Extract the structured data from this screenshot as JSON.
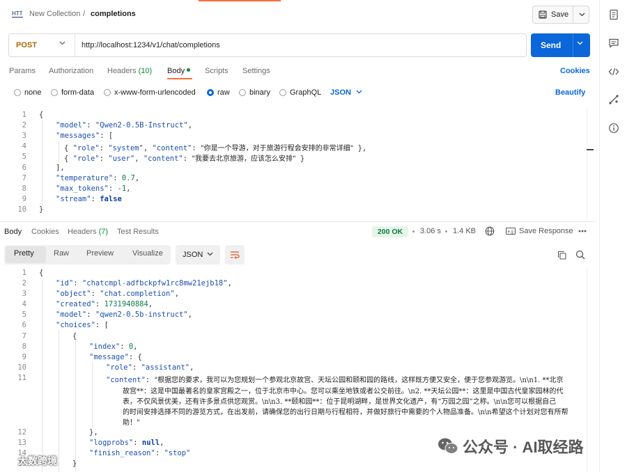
{
  "header": {
    "collection": "New Collection",
    "separator": "/",
    "request_name": "completions",
    "save_label": "Save"
  },
  "url_bar": {
    "method": "POST",
    "url": "http://localhost:1234/v1/chat/completions",
    "send_label": "Send"
  },
  "request_tabs": {
    "params": "Params",
    "authorization": "Authorization",
    "headers": "Headers",
    "headers_count": "(10)",
    "body": "Body",
    "scripts": "Scripts",
    "settings": "Settings",
    "cookies": "Cookies"
  },
  "body_types": {
    "none": "none",
    "form_data": "form-data",
    "urlencoded": "x-www-form-urlencoded",
    "raw": "raw",
    "binary": "binary",
    "graphql": "GraphQL",
    "format": "JSON",
    "beautify": "Beautify"
  },
  "request_body": {
    "lines": [
      "1",
      "2",
      "3",
      "4",
      "5",
      "6",
      "7",
      "8",
      "9",
      "10"
    ],
    "model_key": "\"model\"",
    "model_val": "\"Qwen2-0.5B-Instruct\"",
    "messages_key": "\"messages\"",
    "role_key": "\"role\"",
    "content_key": "\"content\"",
    "system_val": "\"system\"",
    "system_content": "\"你是一个导游，对于旅游行程会安排的非常详细\"",
    "user_val": "\"user\"",
    "user_content": "\"我要去北京旅游，应该怎么安排\"",
    "temperature_key": "\"temperature\"",
    "temperature_val": "0.7",
    "max_tokens_key": "\"max_tokens\"",
    "max_tokens_val": "-1",
    "stream_key": "\"stream\"",
    "stream_val": "false"
  },
  "response_tabs": {
    "body": "Body",
    "cookies": "Cookies",
    "headers": "Headers",
    "headers_count": "(7)",
    "test_results": "Test Results",
    "status": "200 OK",
    "time": "3.06 s",
    "size": "1.4 KB",
    "save_response": "Save Response"
  },
  "view_tabs": {
    "pretty": "Pretty",
    "raw": "Raw",
    "preview": "Preview",
    "visualize": "Visualize",
    "format": "JSON"
  },
  "response_body": {
    "lines": [
      "1",
      "2",
      "3",
      "4",
      "5",
      "6",
      "7",
      "8",
      "9",
      "10",
      "11",
      "12",
      "13",
      "14",
      "15"
    ],
    "id_key": "\"id\"",
    "id_val": "\"chatcmpl-adfbckpfw1rc8mw21ejb18\"",
    "object_key": "\"object\"",
    "object_val": "\"chat.completion\"",
    "created_key": "\"created\"",
    "created_val": "1731940884",
    "model_key": "\"model\"",
    "model_val": "\"qwen2-0.5b-instruct\"",
    "choices_key": "\"choices\"",
    "index_key": "\"index\"",
    "index_val": "0",
    "message_key": "\"message\"",
    "role_key": "\"role\"",
    "role_val": "\"assistant\"",
    "content_key": "\"content\"",
    "content_line1": "\"根据您的要求，我可以为您规划一个参观北京故宫、天坛公园和颐和园的路线，这样既方便又安全，便于您参观游览。\\n\\n1. **北京",
    "content_line2": "故宫**：这是中国最著名的皇家宫殿之一，位于北京市中心。您可以乘坐地铁或者公交前往。\\n2. **天坛公园**：这里是中国古代皇家园林的代",
    "content_line3": "表，不仅风景优美，还有许多景点供您观赏。\\n\\n3. **颐和园**：位于昆明湖畔，是世界文化遗产，有“万园之园”之称。\\n\\n您可以根据自己",
    "content_line4": "的时间安排选择不同的游览方式，在出发前，请确保您的出行日期与行程相符，并做好旅行中需要的个人物品准备。\\n\\n希望这个计划对您有所帮",
    "content_line5": "助！\"",
    "logprobs_key": "\"logprobs\"",
    "logprobs_val": "null",
    "finish_key": "\"finish_reason\"",
    "finish_val": "\"stop\""
  },
  "watermarks": {
    "right": "公众号 · AI取经路",
    "left": "大数跨境"
  }
}
